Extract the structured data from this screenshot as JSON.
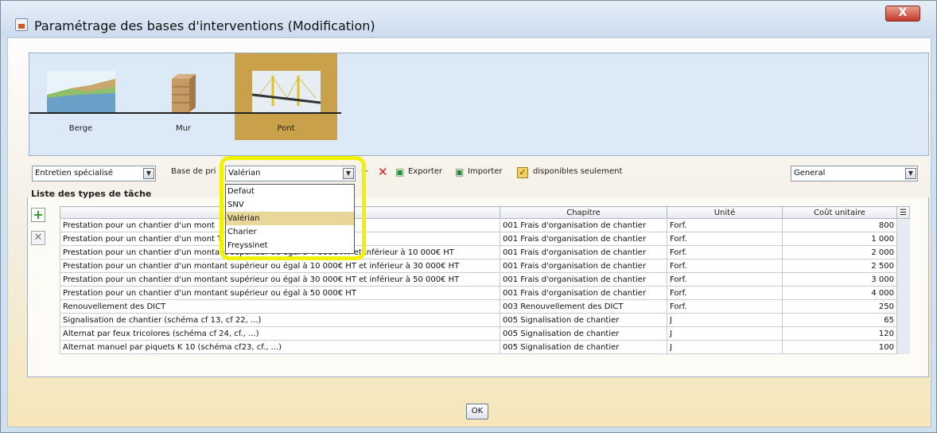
{
  "window": {
    "title": "Paramétrage des bases d'interventions (Modification)",
    "close_label": "X"
  },
  "categories": [
    {
      "label": "Berge",
      "icon": "riverbank-icon"
    },
    {
      "label": "Mur",
      "icon": "wall-icon"
    },
    {
      "label": "Pont",
      "icon": "bridge-icon",
      "selected": true
    }
  ],
  "toolbar": {
    "type_value": "Entretien spécialisé",
    "base_label": "Base de pri",
    "base_value": "Valérian",
    "export_label": "Exporter",
    "import_label": "Importer",
    "available_only_label": "disponibles seulement",
    "available_only_checked": true,
    "general_value": "General"
  },
  "dropdown": {
    "options": [
      "Defaut",
      "SNV",
      "Valérian",
      "Charier",
      "Freyssinet"
    ],
    "selected": "Valérian"
  },
  "list": {
    "title": "Liste des types de tâche",
    "columns": [
      "",
      "Chapitre",
      "Unité",
      "Coût unitaire"
    ],
    "rows": [
      [
        "Prestation pour un chantier d'un mont",
        "001 Frais d'organisation de chantier",
        "Forf.",
        "800"
      ],
      [
        "Prestation pour un chantier d'un mont                                     T et inférieur à 4 000€ HT",
        "001 Frais d'organisation de chantier",
        "Forf.",
        "1 000"
      ],
      [
        "Prestation pour un chantier d'un montant supérieur ou égal à 4 000€ HT et inférieur à 10 000€ HT",
        "001 Frais d'organisation de chantier",
        "Forf.",
        "2 000"
      ],
      [
        "Prestation pour un chantier d'un montant supérieur ou égal à 10 000€ HT et inférieur à 30 000€ HT",
        "001 Frais d'organisation de chantier",
        "Forf.",
        "2 500"
      ],
      [
        "Prestation pour un chantier d'un montant supérieur ou égal à 30 000€ HT et inférieur à 50 000€ HT",
        "001 Frais d'organisation de chantier",
        "Forf.",
        "3 000"
      ],
      [
        "Prestation pour un chantier d'un montant supérieur ou égal à 50 000€ HT",
        "001 Frais d'organisation de chantier",
        "Forf.",
        "4 000"
      ],
      [
        "Renouvellement des DICT",
        "003 Renouvellement des DICT",
        "Forf.",
        "250"
      ],
      [
        "Signalisation de chantier (schéma cf 13, cf 22, ...)",
        "005 Signalisation de chantier",
        "J",
        "65"
      ],
      [
        "Alternat par feux tricolores (schéma cf 24, cf., ...)",
        "005 Signalisation de chantier",
        "J",
        "120"
      ],
      [
        "Alternat manuel par piquets K 10 (schéma cf23, cf., ...)",
        "005 Signalisation de chantier",
        "J",
        "100"
      ]
    ]
  },
  "ok_label": "OK",
  "colors": {
    "highlight": "#f2f200",
    "selected_category": "#c8a14a",
    "dropdown_selected": "#e9d79a"
  }
}
